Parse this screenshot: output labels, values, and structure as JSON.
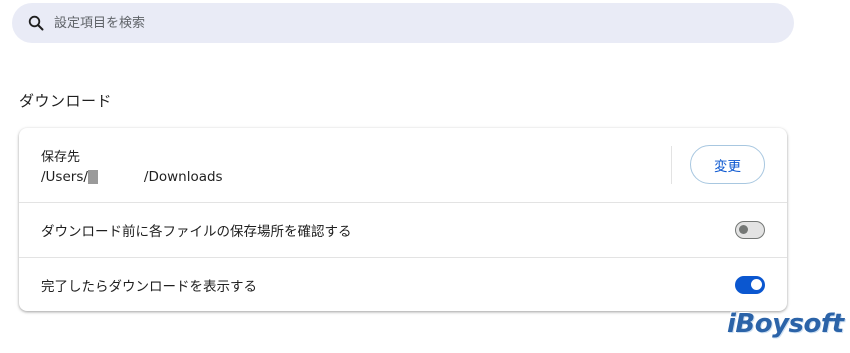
{
  "search": {
    "placeholder": "設定項目を検索",
    "icon": "search-icon"
  },
  "section": {
    "title": "ダウンロード"
  },
  "location": {
    "label": "保存先",
    "path_prefix": "/Users/",
    "path_suffix": "/Downloads",
    "change_label": "変更"
  },
  "settings": [
    {
      "label": "ダウンロード前に各ファイルの保存場所を確認する",
      "enabled": false
    },
    {
      "label": "完了したらダウンロードを表示する",
      "enabled": true
    }
  ],
  "watermark": {
    "text": "iBoysoft"
  },
  "colors": {
    "accent": "#0b57d0",
    "search_bg": "#e9ebf6",
    "watermark": "#2b63a8"
  }
}
